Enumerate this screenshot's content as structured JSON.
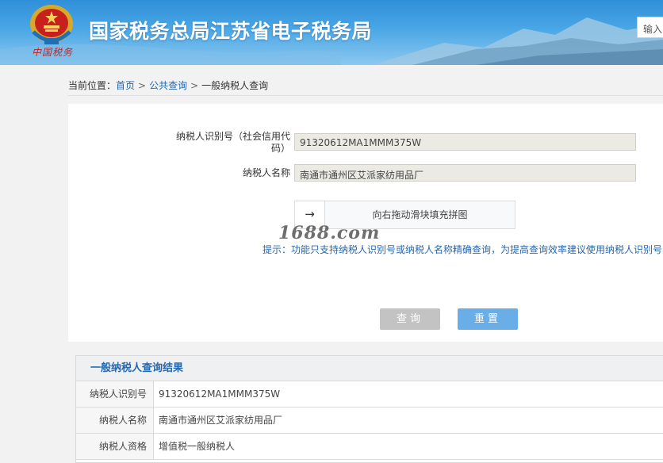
{
  "header": {
    "title": "国家税务总局江苏省电子税务局",
    "signature": "中国税务",
    "search_placeholder": "输入"
  },
  "breadcrumb": {
    "prefix": "当前位置：",
    "items": [
      "首页",
      "公共查询",
      "一般纳税人查询"
    ],
    "separator": ">"
  },
  "form": {
    "id_label_line1": "纳税人识别号（社会信用代",
    "id_label_line2": "码）",
    "id_value": "91320612MA1MMM375W",
    "name_label": "纳税人名称",
    "name_value": "南通市通州区艾派家纺用品厂",
    "slider_arrow": "→",
    "slider_text": "向右拖动滑块填充拼图",
    "watermark": "1688.com",
    "tip_label": "提示：",
    "tip_text": "功能只支持纳税人识别号或纳税人名称精确查询，为提高查询效率建议使用纳税人识别号",
    "query_button": "查询",
    "reset_button": "重置"
  },
  "results": {
    "title": "一般纳税人查询结果",
    "rows": [
      {
        "key": "纳税人识别号",
        "value": "91320612MA1MMM375W"
      },
      {
        "key": "纳税人名称",
        "value": "南通市通州区艾派家纺用品厂"
      },
      {
        "key": "纳税人资格",
        "value": "增值税一般纳税人"
      }
    ]
  },
  "colors": {
    "header_blue": "#2f8fd8",
    "link_blue": "#2468b0",
    "reset_button": "#6aaee8",
    "query_button": "#c3c3c3"
  }
}
